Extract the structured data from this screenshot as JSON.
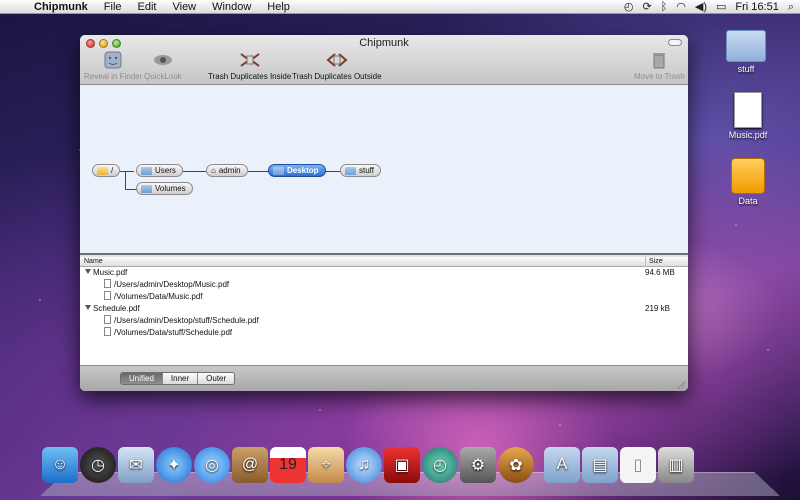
{
  "menubar": {
    "app_name": "Chipmunk",
    "menus": [
      "File",
      "Edit",
      "View",
      "Window",
      "Help"
    ],
    "clock": "Fri 16:51"
  },
  "window": {
    "title": "Chipmunk",
    "toolbar": {
      "reveal": "Reveal in Finder",
      "quicklook": "QuickLook",
      "trash_inside": "Trash Duplicates Inside",
      "trash_outside": "Trash Duplicates Outside",
      "move_to_trash": "Move to Trash"
    },
    "path_nodes": {
      "root": "/",
      "users": "Users",
      "volumes": "Volumes",
      "admin": "admin",
      "desktop": "Desktop",
      "stuff": "stuff"
    },
    "list": {
      "col_name": "Name",
      "col_size": "Size",
      "groups": [
        {
          "name": "Music.pdf",
          "size": "94.6 MB",
          "files": [
            "/Users/admin/Desktop/Music.pdf",
            "/Volumes/Data/Music.pdf"
          ]
        },
        {
          "name": "Schedule.pdf",
          "size": "219 kB",
          "files": [
            "/Users/admin/Desktop/stuff/Schedule.pdf",
            "/Volumes/Data/stuff/Schedule.pdf"
          ]
        }
      ]
    },
    "segments": [
      "Unified",
      "Inner",
      "Outer"
    ],
    "active_segment": "Unified"
  },
  "desktop_icons": [
    "stuff",
    "Music.pdf",
    "Data"
  ],
  "dock": [
    "Finder",
    "Dashboard",
    "Mail",
    "Safari",
    "iChat",
    "Address Book",
    "iCal",
    "Preview",
    "iTunes",
    "Photo Booth",
    "Time Machine",
    "System Preferences",
    "Chipmunk",
    "Applications",
    "Documents",
    "File",
    "Trash"
  ]
}
